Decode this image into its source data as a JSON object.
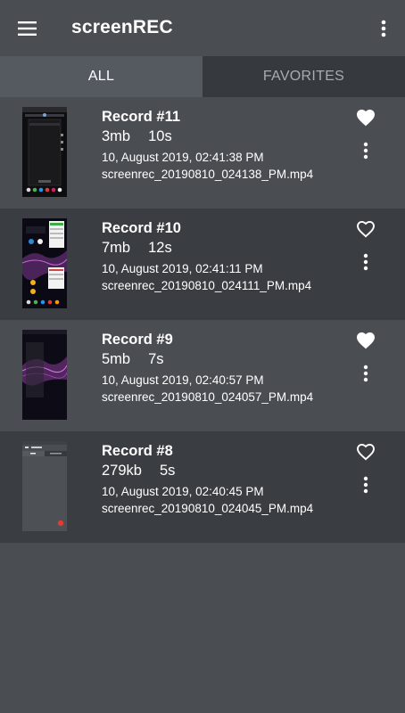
{
  "app": {
    "title": "screenREC"
  },
  "icons": {
    "menu": "hamburger-menu-icon",
    "overflow": "more-vertical-icon",
    "favorite_filled": "heart-filled-icon",
    "favorite_outline": "heart-outline-icon",
    "item_menu": "more-vertical-icon"
  },
  "tabs": [
    {
      "label": "ALL",
      "selected": true
    },
    {
      "label": "FAVORITES",
      "selected": false
    }
  ],
  "records": [
    {
      "title": "Record #11",
      "size": "3mb",
      "duration": "10s",
      "date": "10, August 2019, 02:41:38 PM",
      "filename": "screenrec_20190810_024138_PM.mp4",
      "favorite": true
    },
    {
      "title": "Record #10",
      "size": "7mb",
      "duration": "12s",
      "date": "10, August 2019, 02:41:11 PM",
      "filename": "screenrec_20190810_024111_PM.mp4",
      "favorite": false
    },
    {
      "title": "Record #9",
      "size": "5mb",
      "duration": "7s",
      "date": "10, August 2019, 02:40:57 PM",
      "filename": "screenrec_20190810_024057_PM.mp4",
      "favorite": true
    },
    {
      "title": "Record #8",
      "size": "279kb",
      "duration": "5s",
      "date": "10, August 2019, 02:40:45 PM",
      "filename": "screenrec_20190810_024045_PM.mp4",
      "favorite": false
    }
  ],
  "colors": {
    "background": "#4a4e53",
    "row_alt": "#3a3d41",
    "tab_selected": "#555a60",
    "tab_unselected": "#36393d",
    "text": "#ffffff",
    "text_muted": "#a8acb1"
  }
}
